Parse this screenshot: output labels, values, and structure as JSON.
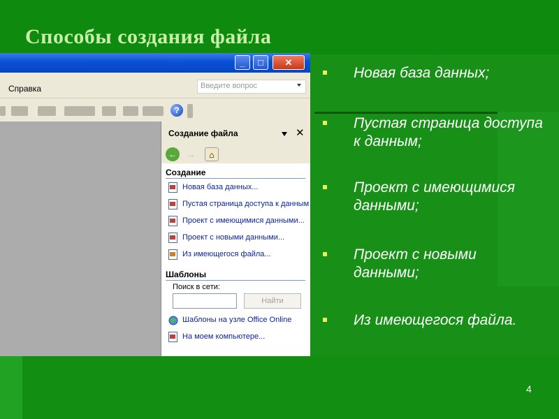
{
  "slide": {
    "title": "Способы создания файла",
    "page_number": "4",
    "bullets": [
      "Новая база данных;",
      "Пустая страница доступа к данным;",
      "Проект с имеющимися данными;",
      "Проект с новыми данными;",
      "Из имеющегося файла."
    ]
  },
  "window": {
    "minimize_glyph": "_",
    "maximize_glyph": "□",
    "close_glyph": "✕",
    "menu_help": "Справка",
    "question_placeholder": "Введите вопрос",
    "help_icon_glyph": "?"
  },
  "task_pane": {
    "title": "Создание файла",
    "close_glyph": "✕",
    "section_create": "Создание",
    "create_links": [
      "Новая база данных...",
      "Пустая страница доступа к данным",
      "Проект с имеющимися данными...",
      "Проект с новыми данными...",
      "Из имеющегося файла..."
    ],
    "section_templates": "Шаблоны",
    "search_label": "Поиск в сети:",
    "search_value": "",
    "find_button": "Найти",
    "template_links": [
      "Шаблоны на узле Office Online",
      "На моем компьютере..."
    ]
  },
  "colors": {
    "slide_bg": "#189018",
    "title_color": "#c8f0a8",
    "bullet_marker": "#e8f060",
    "link_color": "#0a24a0",
    "titlebar_blue": "#0a50d8"
  }
}
